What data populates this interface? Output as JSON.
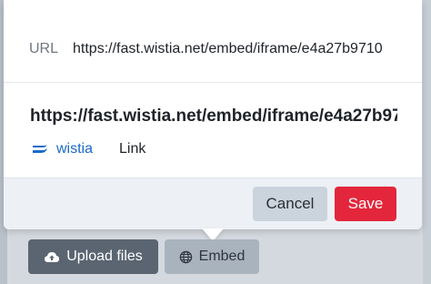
{
  "url_field": {
    "label": "URL",
    "value": "https://fast.wistia.net/embed/iframe/e4a27b9710"
  },
  "preview": {
    "url": "https://fast.wistia.net/embed/iframe/e4a27b97",
    "provider_name": "wistia",
    "provider_icon": "wistia-logo-icon",
    "type": "Link"
  },
  "actions": {
    "cancel_label": "Cancel",
    "save_label": "Save"
  },
  "toolbar": {
    "upload_label": "Upload files",
    "upload_icon": "cloud-upload-icon",
    "embed_label": "Embed",
    "embed_icon": "globe-icon"
  },
  "colors": {
    "save_button": "#e3263b",
    "provider_link": "#1b6ac9",
    "upload_button": "#5a6571",
    "embed_button": "#a9b3be"
  }
}
